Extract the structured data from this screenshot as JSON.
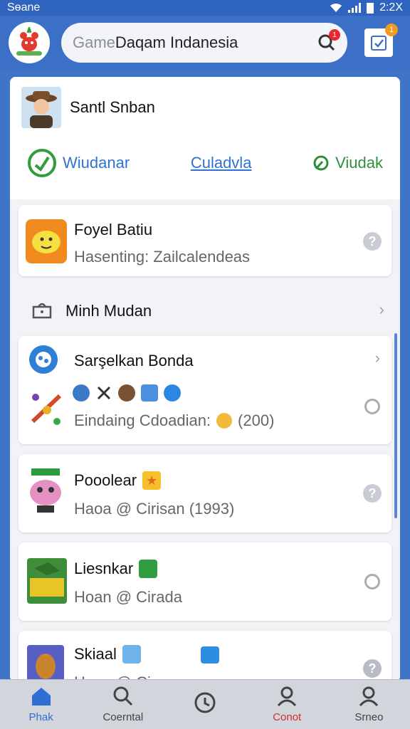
{
  "status": {
    "carrier": "Sɵane",
    "time": "2:2X"
  },
  "appbar": {
    "logo_icon": "app-logo-icon",
    "search_muted": "Game",
    "search_text": " Daqam Indanesia",
    "search_badge": "1",
    "notify_badge": "1"
  },
  "profile": {
    "name": "Santl Snban",
    "links": [
      {
        "label": "Wiudanar",
        "icon": "check-circle-icon"
      },
      {
        "label": "Culadvla"
      },
      {
        "label": "Viudak",
        "icon": "leaf-icon"
      }
    ]
  },
  "featured": {
    "title": "Foyel Batiu",
    "subtitle": "Hasenting: Zailcalendeas"
  },
  "section": {
    "label": "Minh Mudan"
  },
  "rows": [
    {
      "title": "Sarşelkan Bonda",
      "subtitle": "Eindaing Cdoadian:",
      "count": "(200)"
    },
    {
      "title": "Pooolear",
      "subtitle": "Haoa @ Cirisan (1993)"
    },
    {
      "title": "Liesnkar",
      "subtitle": "Hoan @ Cirada"
    },
    {
      "title": "Skiaal",
      "subtitle": "Haoa @ Ci..."
    }
  ],
  "tabs": [
    {
      "label": "Phak"
    },
    {
      "label": "Coerntal"
    },
    {
      "label": ""
    },
    {
      "label": "Conot"
    },
    {
      "label": "Srneo"
    }
  ],
  "colors": {
    "header_blue": "#3b70c6",
    "accent_blue": "#2e72d2",
    "accent_green": "#2f8f3b",
    "badge_red": "#e8282a",
    "badge_orange": "#f39a1e"
  }
}
